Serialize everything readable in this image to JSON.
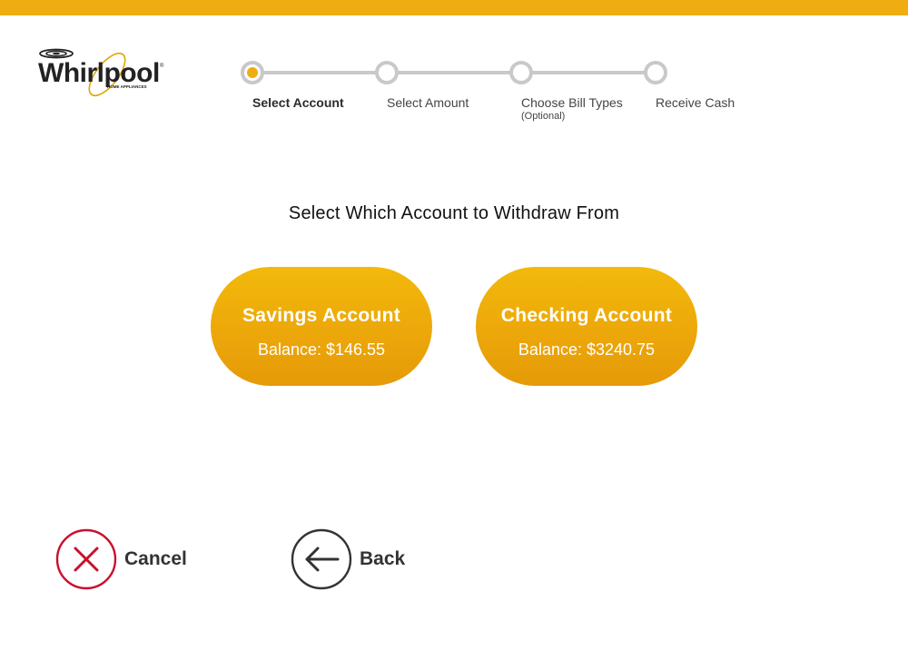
{
  "brand": {
    "logo_text": "Whirlpool",
    "logo_tagline": "HOME APPLIANCES",
    "accent_color": "#f0ad12",
    "top_bar_color": "#f0ad12"
  },
  "stepper": {
    "steps": [
      {
        "label": "Select Account",
        "sublabel": "",
        "active": true
      },
      {
        "label": "Select Amount",
        "sublabel": "",
        "active": false
      },
      {
        "label": "Choose Bill Types",
        "sublabel": "(Optional)",
        "active": false
      },
      {
        "label": "Receive Cash",
        "sublabel": "",
        "active": false
      }
    ]
  },
  "main": {
    "heading": "Select Which Account to Withdraw From",
    "accounts": [
      {
        "name": "Savings Account",
        "balance": "Balance: $146.55"
      },
      {
        "name": "Checking Account",
        "balance": "Balance: $3240.75"
      }
    ]
  },
  "actions": {
    "cancel_label": "Cancel",
    "cancel_icon": "close-icon",
    "cancel_color": "#c8102e",
    "back_label": "Back",
    "back_icon": "arrow-left-icon"
  }
}
